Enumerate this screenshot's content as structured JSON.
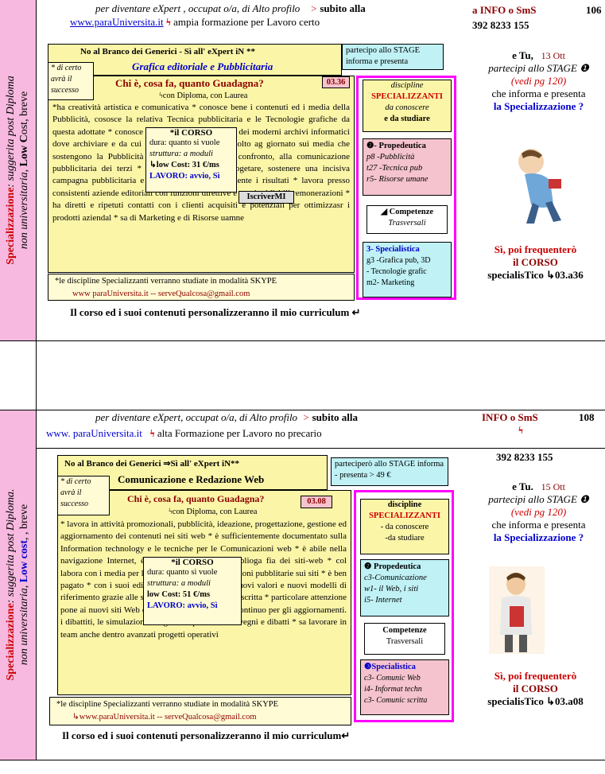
{
  "row1": {
    "side": {
      "main": "Specializzazione",
      "rest1": ": suggerita post Diploma",
      "rest2": "non universitaria, ",
      "low": "Low C",
      "ost": "ost, breve"
    },
    "top_line": "per diventare eXpert , occupat o/a,  di Alto profilo",
    "top_arrow": ">",
    "top_end": "subito alla",
    "website": "www.paraUniversita.it",
    "lightning": "ϟ",
    "website_after": "ampia  formazione per Lavoro certo",
    "info": "a   INFO   o   SmS",
    "page": "106",
    "phone": "392 8233 155",
    "branco": "No  al  Branco dei Generici - Sì  all' eXpert iN **",
    "course_title": "Grafica  editoriale  e  Pubblicitaria",
    "certo": "* di certo avrà il successo",
    "partecipo": "partecipo allo STAGE informa e presenta",
    "question": "Chi è, cosa fa, quanto Guadagna?",
    "code": "03.36",
    "con_diploma": "ϟcon Diploma, con Laurea",
    "body": "*ha creatività artistica e comunicativa * conosce bene i contenuti ed i media della Pubblicità, cososce la relativa Tecnica pubblicitaria e le Tecnologie grafiche da questa adottate * conosce i contenuti e la manualità dei moderni archivi informatici dove archiviare e da cui prelevare elaborati * è molto ag giornato sui media che sostengono la Pubblicità * è molto sensibile al confronto, alla comunicazione pubblicitaria dei terzi * è in grado anche di progetare, sostenere una incisiva campagna pubblicitaria e di verificarne analiticamente i risultati * lavora presso consistenti aziende editoriali con funzioni direttive e con invidiabili remonerazioni * ha diretti e ripetuti contatti con i clienti acquisiti e potenziali per ottimizzasr i prodotti aziendal * sa di Marketing e di Risorse uamne",
    "corso": {
      "t": "*il CORSO",
      "l1": "dura: quanto si vuole",
      "l2": "struttura: a moduli",
      "l3": "↳low  Cost: 31 €/ms",
      "l4": "LAVORO: avvio, Sì"
    },
    "iscriver": "IscriverMI",
    "skype1": "*le discipline  Specializzanti  verranno studiate  in modalità SKYPE",
    "skype2": "www paraUniversita.it  --  serveQualcosa@gmail.com",
    "discipline": {
      "t1": "discipline",
      "t2": "SPECIALIZZANTI",
      "t3": "da conoscere",
      "t4": "e  da studiare"
    },
    "prop": {
      "t": "❷- Propedeutica",
      "a": "p8 -Pubblicità",
      "b": "t27 -Tecnica pub",
      "c": "r5- Risorse umane"
    },
    "comp": {
      "t": "◢ Competenze",
      "s": "Trasversali"
    },
    "spec": {
      "t": "3- Specialistica",
      "a": "g3 -Grafica pub, 3D",
      "b": "- Tecnologie grafic",
      "c": "m2- Marketing"
    },
    "right1": "e Tu,",
    "right1b": "13 Ott",
    "right2": "partecipi allo STAGE ❶",
    "right3": "(vedi pg 120)",
    "right4": "che informa e presenta",
    "right5": "la Specializzazione ?",
    "right6": "Sì, poi frequenterò",
    "right7": "il CORSO",
    "right8": "specialisTico ↳03.a36",
    "bottom": "Il corso ed i suoi contenuti personalizzeranno il mio curriculum ↵"
  },
  "row3": {
    "side": {
      "main": "Specializzazione",
      "rest1": ": suggerita post Diploma.",
      "rest2": "non universitaria, ",
      "low": "Low cost",
      "ost": ", , breve"
    },
    "top_line": "per diventare  eXpert, occupat o/a, di Alto profilo",
    "top_arrow": ">",
    "top_end": "subito alla",
    "website": "www. paraUniversita.it",
    "lightning": "ϟ",
    "website_after": "alta Formazione  per Lavoro no precario",
    "info": "INFO   o   SmS",
    "info_bolt": "ϟ",
    "page": "108",
    "phone": "392 8233 155",
    "branco": "No  al  Branco dei Generici ⇒Sì  all' eXpert iN**",
    "course_title": "Comunicazione  e Redazione Web",
    "certo": "* di certo avrà il successo",
    "partecipo": "parteciperò allo STAGE informa - presenta  > 49 €",
    "question": "Chi è, cosa fa, quanto Guadagna?",
    "code": "03.08",
    "con_diploma": "ϟcon Diploma, con Laurea",
    "body": "* lavora in attività promozionali, pubblicità, ideazione, progettazione, gestione ed aggiornamento dei contenuti nei siti web * è sufficientemente documentato sulla Information technology e le tecniche per le Comunicazioni web * è abile nella navigazione Internet, è molto informato sulla biblioga fia dei siti-web * col labora con i media per lo sviluppo delle comunicazioni pubblitarie sui siti * è ben pagato * con i suoi editoriali consente ci creare nuovi valori e nuovi modelli di riferimento grazie alle sua capacità di Comuncione scritta * particolare attenzione pone ai nuovi siti Web con i quali si confronta di continuo per gli aggiornamenti. i dibattiti, le simulazioni * organizza periodici convegni e dibatti * sa lavorare in team anche dentro avanzati progetti operativi",
    "corso": {
      "t": "*il CORSO",
      "l1": "dura: quanto si vuole",
      "l2": "struttura: a moduli",
      "l3": "low  Cost: 51 €/ms",
      "l4": "LAVORO: avvio, Sì"
    },
    "skype1": "*le  discipline  Specializzanti  verranno studiate  in modalità SKYPE",
    "skype2": "↳www.paraUniversita.it  --  serveQualcosa@gmail.com",
    "discipline": {
      "t1": "discipline",
      "t2": "SPECIALIZZANTI",
      "t3": "- da conoscere",
      "t4": "-da  studiare"
    },
    "prop": {
      "t": "❷ Propedeutica",
      "a": "c3-Comunicazione",
      "b": "w1- il Web, i siti",
      "c": "i5- Internet"
    },
    "comp": {
      "t": "Competenze",
      "s": "Trasversali"
    },
    "spec": {
      "t": "❸Specialistica",
      "a": "c3- Comunic Web",
      "b": "i4- Informat  techn",
      "c": "c3- Comunic scritta"
    },
    "right1": "e  Tu.",
    "right1b": "15 Ott",
    "right2": "partecipi allo STAGE ❶",
    "right3": "(vedi pg 120)",
    "right4": "che  informa  e presenta",
    "right5": "la Specializzazione ?",
    "right6": "Sì, poi frequenterò",
    "right7": "il CORSO",
    "right8": "specialisTico ↳03.a08",
    "bottom": "Il corso ed i suoi contenuti personalizzeranno il mio curriculum↵"
  }
}
